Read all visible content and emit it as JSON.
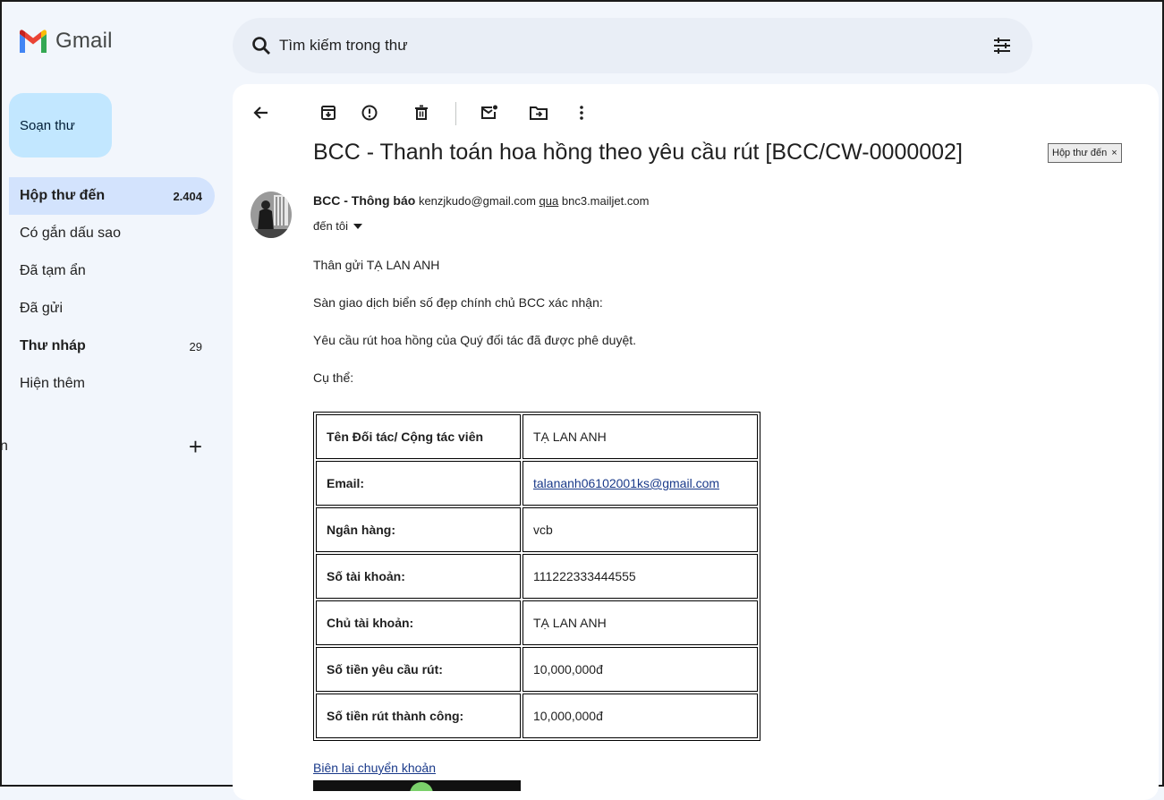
{
  "app": {
    "title": "Gmail"
  },
  "search": {
    "placeholder": "Tìm kiếm trong thư"
  },
  "sidebar": {
    "compose_label": "Soạn thư",
    "items": [
      {
        "label": "Hộp thư đến",
        "count": "2.404"
      },
      {
        "label": "Có gắn dấu sao",
        "count": ""
      },
      {
        "label": "Đã tạm ẩn",
        "count": ""
      },
      {
        "label": "Đã gửi",
        "count": ""
      },
      {
        "label": "Thư nháp",
        "count": "29"
      },
      {
        "label": "Hiện thêm",
        "count": ""
      }
    ],
    "labels_heading": "n",
    "labels_add": "+"
  },
  "email": {
    "subject": "BCC - Thanh toán hoa hồng theo yêu cầu rút [BCC/CW-0000002]",
    "tag": "Hộp thư đến",
    "tag_close": "×",
    "sender_name": "BCC - Thông báo",
    "sender_email": "kenzjkudo@gmail.com",
    "via_label": "qua",
    "via_domain": "bnc3.mailjet.com",
    "recipient": "đến tôi",
    "greeting": "Thân gửi TẠ LAN ANH",
    "line1": "Sàn giao dịch biển số đẹp chính chủ BCC xác nhận:",
    "line2": "Yêu cầu rút hoa hồng của Quý đối tác đã được phê duyệt.",
    "line3": "Cụ thể:",
    "table": [
      {
        "key": "Tên Đối tác/ Cộng tác viên",
        "value": "TẠ LAN ANH"
      },
      {
        "key": "Email:",
        "value": "talananh06102001ks@gmail.com"
      },
      {
        "key": "Ngân hàng:",
        "value": "vcb"
      },
      {
        "key": "Số tài khoản:",
        "value": "111222333444555"
      },
      {
        "key": "Chủ tài khoản:",
        "value": "TẠ LAN ANH"
      },
      {
        "key": "Số tiền yêu cầu rút:",
        "value": "10,000,000đ"
      },
      {
        "key": "Số tiền rút thành công:",
        "value": "10,000,000đ"
      }
    ],
    "receipt_link": "Biên lai chuyển khoản"
  },
  "colors": {
    "background": "#f2f6fc",
    "compose": "#c2e7ff",
    "active_nav": "#d3e3fd",
    "search": "#e9eef6",
    "link": "#1a3a8a"
  },
  "icons": {
    "toolbar": [
      "back-arrow-icon",
      "archive-icon",
      "report-spam-icon",
      "delete-icon",
      "mark-unread-icon",
      "move-to-icon",
      "more-vert-icon"
    ],
    "search": "search-icon",
    "filter": "filter-options-icon"
  }
}
